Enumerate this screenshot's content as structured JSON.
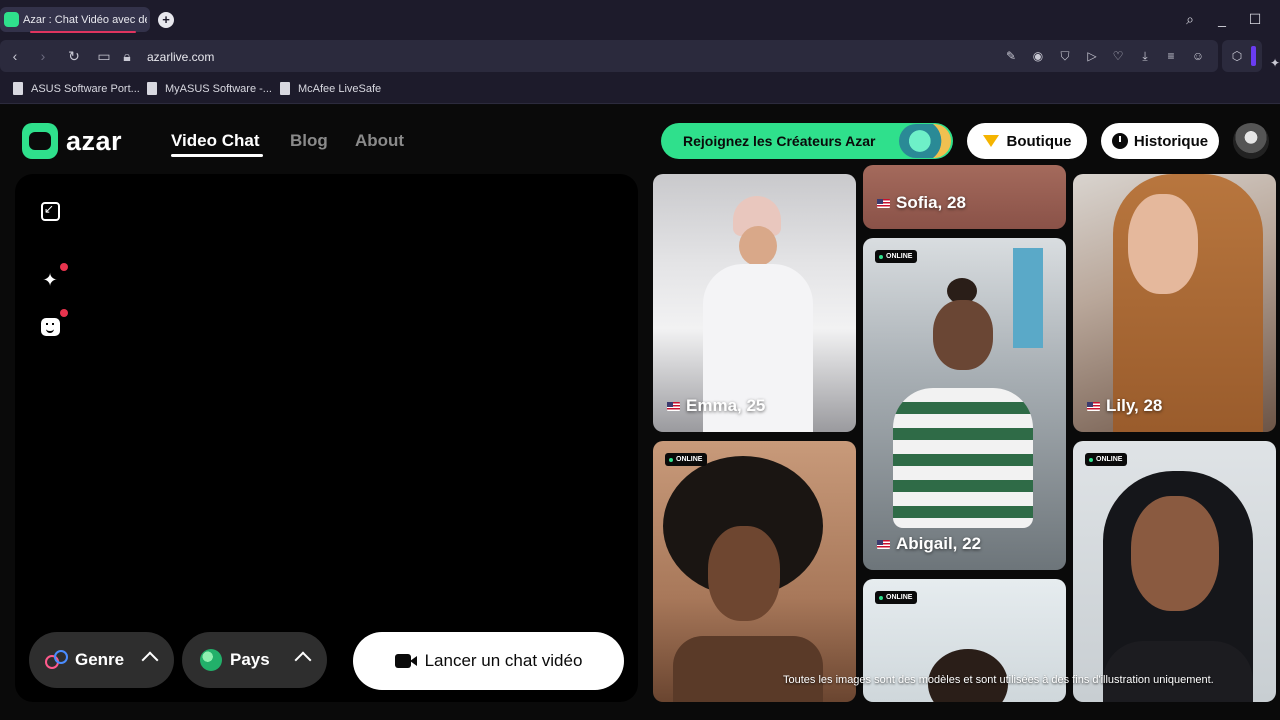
{
  "browser": {
    "tab_title": "Azar : Chat Vidéo avec de",
    "url": "azarlive.com",
    "bookmarks": [
      "ASUS Software Port...",
      "MyASUS Software -...",
      "McAfee LiveSafe"
    ]
  },
  "site": {
    "logo_text": "azar",
    "nav": {
      "video_chat": "Video Chat",
      "blog": "Blog",
      "about": "About"
    },
    "creators_button": "Rejoignez les Créateurs Azar",
    "boutique_button": "Boutique",
    "history_button": "Historique"
  },
  "controls": {
    "gender_label": "Genre",
    "country_label": "Pays",
    "launch_label": "Lancer un chat vidéo"
  },
  "profiles": {
    "emma": "Emma, 25",
    "sofia": "Sofia, 28",
    "lily": "Lily, 28",
    "abigail": "Abigail, 22",
    "online_badge": "ONLINE"
  },
  "disclaimer": "Toutes les images sont des modèles et sont utilisées à des fins d'illustration uniquement.",
  "colors": {
    "accent": "#2fe08c",
    "panel": "#000000",
    "pill_dark": "#2e2e2e",
    "notification": "#e8344e"
  }
}
